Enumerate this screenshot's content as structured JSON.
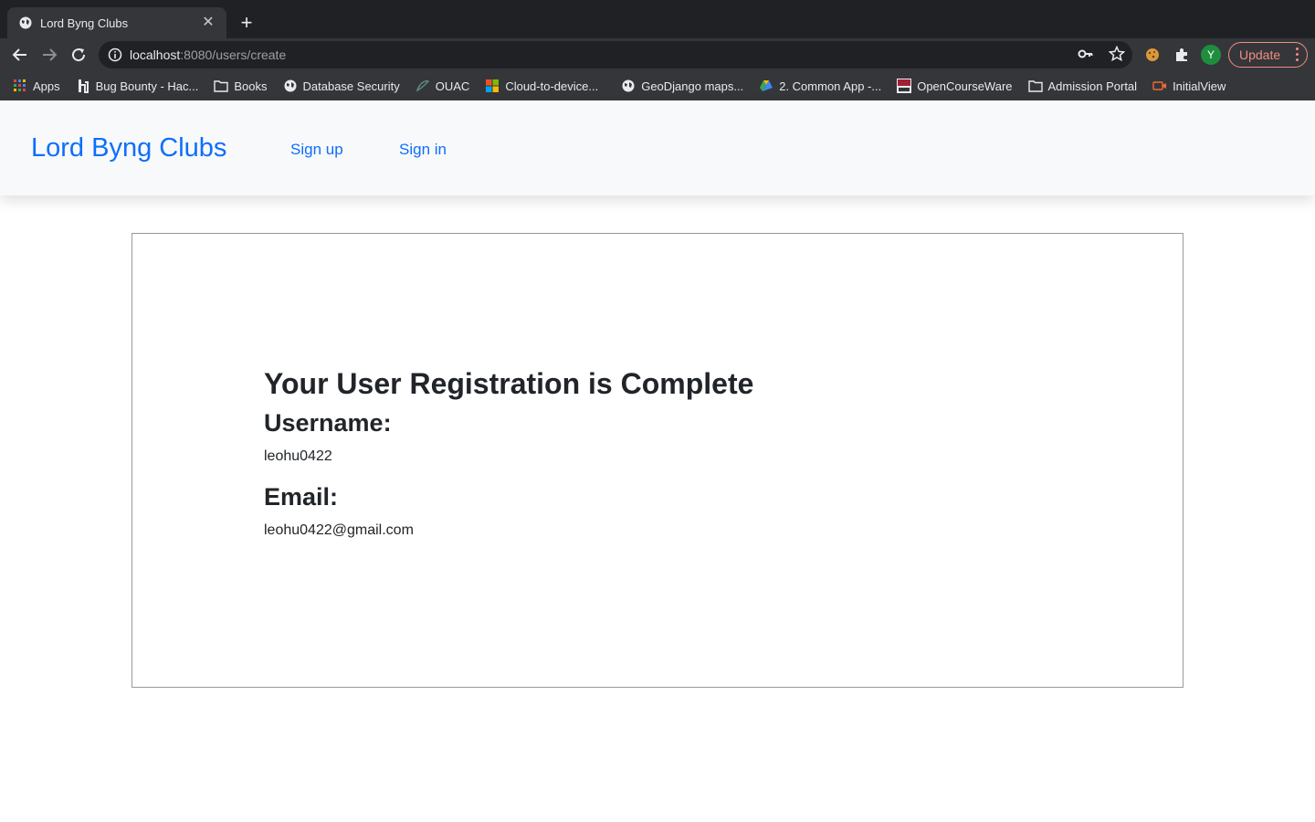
{
  "browser": {
    "tab_title": "Lord Byng Clubs",
    "url_host": "localhost",
    "url_rest": ":8080/users/create",
    "profile_initial": "Y",
    "update_label": "Update",
    "bookmarks": [
      {
        "label": "Apps",
        "icon": "apps-grid-icon"
      },
      {
        "label": "Bug Bounty - Hac...",
        "icon": "hackerone-icon"
      },
      {
        "label": "Books",
        "icon": "folder-icon"
      },
      {
        "label": "Database Security",
        "icon": "globe-icon"
      },
      {
        "label": "OUAC",
        "icon": "ouac-icon"
      },
      {
        "label": "Cloud-to-device...",
        "icon": "microsoft-icon"
      },
      {
        "label": "GeoDjango maps...",
        "icon": "globe-icon"
      },
      {
        "label": "2. Common App -...",
        "icon": "google-drive-icon"
      },
      {
        "label": "OpenCourseWare",
        "icon": "mit-ocw-icon"
      },
      {
        "label": "Admission Portal",
        "icon": "folder-icon"
      },
      {
        "label": "InitialView",
        "icon": "video-icon"
      }
    ]
  },
  "navbar": {
    "brand": "Lord Byng Clubs",
    "links": [
      "Sign up",
      "Sign in"
    ]
  },
  "confirmation": {
    "heading": "Your User Registration is Complete",
    "username_label": "Username:",
    "username": "leohu0422",
    "email_label": "Email:",
    "email": "leohu0422@gmail.com"
  },
  "colors": {
    "link": "#0d6efd",
    "navbar_bg": "#f8f9fa",
    "chrome_dark": "#202124",
    "chrome_toolbar": "#35363a"
  }
}
